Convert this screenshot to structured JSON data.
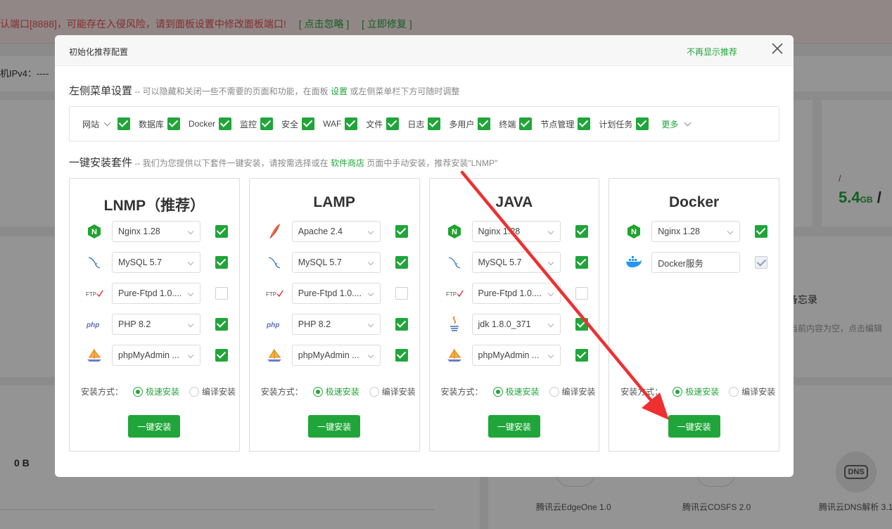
{
  "background": {
    "warning_text": "认端口[8888]，可能存在入侵风险，请到面板设置中修改面板端口!",
    "warning_ignore": "[ 点击忽略 ]",
    "warning_fix": "[ 立即修复 ]",
    "ipv4": "机IPv4：----",
    "mem_slash": "/",
    "mem_value": "5.4",
    "mem_unit": "GB",
    "mem_slash2": "/",
    "memo_title": "备忘录",
    "memo_hint": "当前内容为空，点击编辑",
    "traffic": "0 B",
    "tools": [
      "腾讯云EdgeOne 1.0",
      "腾讯云COSFS 2.0",
      "腾讯云DNS解析 3.1"
    ],
    "dns_badge": "DNS"
  },
  "modal": {
    "title": "初始化推荐配置",
    "dont_show": "不再显示推荐",
    "close_icon": "close-icon",
    "menu_section": {
      "title": "左侧菜单设置",
      "desc_prefix": " -- 可以隐藏和关闭一些不需要的页面和功能，在面板 ",
      "desc_link": "设置",
      "desc_suffix": " 或左侧菜单栏下方可随时调整",
      "items": [
        {
          "label": "网站",
          "has_dropdown": true,
          "checked": true
        },
        {
          "label": "数据库",
          "checked": true
        },
        {
          "label": "Docker",
          "checked": true
        },
        {
          "label": "监控",
          "checked": true
        },
        {
          "label": "安全",
          "checked": true
        },
        {
          "label": "WAF",
          "checked": true
        },
        {
          "label": "文件",
          "checked": true
        },
        {
          "label": "日志",
          "checked": true
        },
        {
          "label": "多用户",
          "checked": true
        },
        {
          "label": "终端",
          "checked": true
        },
        {
          "label": "节点管理",
          "checked": true
        },
        {
          "label": "计划任务",
          "checked": true
        }
      ],
      "more": "更多"
    },
    "install_section": {
      "title": "一键安装套件",
      "desc_prefix": " -- 我们为您提供以下套件一键安装，请按需选择或在 ",
      "desc_link": "软件商店",
      "desc_suffix": " 页面中手动安装，推荐安装\"LNMP\""
    },
    "cards": [
      {
        "title": "LNMP（推荐）",
        "rows": [
          {
            "icon": "nginx-icon",
            "value": "Nginx 1.28",
            "checked": true
          },
          {
            "icon": "mysql-icon",
            "value": "MySQL 5.7",
            "checked": true
          },
          {
            "icon": "ftp-icon",
            "value": "Pure-Ftpd 1.0....",
            "checked": false
          },
          {
            "icon": "php-icon",
            "value": "PHP 8.2",
            "checked": true
          },
          {
            "icon": "phpmyadmin-icon",
            "value": "phpMyAdmin ...",
            "checked": true
          }
        ],
        "mode_label": "安装方式：",
        "mode_fast": "极速安装",
        "mode_compile": "编译安装",
        "mode_selected": "fast",
        "button": "一键安装"
      },
      {
        "title": "LAMP",
        "rows": [
          {
            "icon": "apache-icon",
            "value": "Apache 2.4",
            "checked": true
          },
          {
            "icon": "mysql-icon",
            "value": "MySQL 5.7",
            "checked": true
          },
          {
            "icon": "ftp-icon",
            "value": "Pure-Ftpd 1.0....",
            "checked": false
          },
          {
            "icon": "php-icon",
            "value": "PHP 8.2",
            "checked": true
          },
          {
            "icon": "phpmyadmin-icon",
            "value": "phpMyAdmin ...",
            "checked": true
          }
        ],
        "mode_label": "安装方式：",
        "mode_fast": "极速安装",
        "mode_compile": "编译安装",
        "mode_selected": "fast",
        "button": "一键安装"
      },
      {
        "title": "JAVA",
        "rows": [
          {
            "icon": "nginx-icon",
            "value": "Nginx 1.28",
            "checked": true
          },
          {
            "icon": "mysql-icon",
            "value": "MySQL 5.7",
            "checked": true
          },
          {
            "icon": "ftp-icon",
            "value": "Pure-Ftpd 1.0....",
            "checked": false
          },
          {
            "icon": "java-icon",
            "value": "jdk 1.8.0_371",
            "checked": true
          },
          {
            "icon": "phpmyadmin-icon",
            "value": "phpMyAdmin ...",
            "checked": true
          }
        ],
        "mode_label": "安装方式：",
        "mode_fast": "极速安装",
        "mode_compile": "编译安装",
        "mode_selected": "fast",
        "button": "一键安装"
      },
      {
        "title": "Docker",
        "rows": [
          {
            "icon": "nginx-icon",
            "value": "Nginx 1.28",
            "checked": true
          },
          {
            "icon": "docker-icon",
            "value": "Docker服务",
            "checked": true,
            "disabled": true
          }
        ],
        "mode_label": "安装方式：",
        "mode_fast": "极速安装",
        "mode_compile": "编译安装",
        "mode_selected": "fast",
        "button": "一键安装"
      }
    ]
  },
  "annotation": {
    "arrow_color": "#ee3030"
  },
  "colors": {
    "accent": "#20a53a",
    "warning": "#e05050"
  }
}
